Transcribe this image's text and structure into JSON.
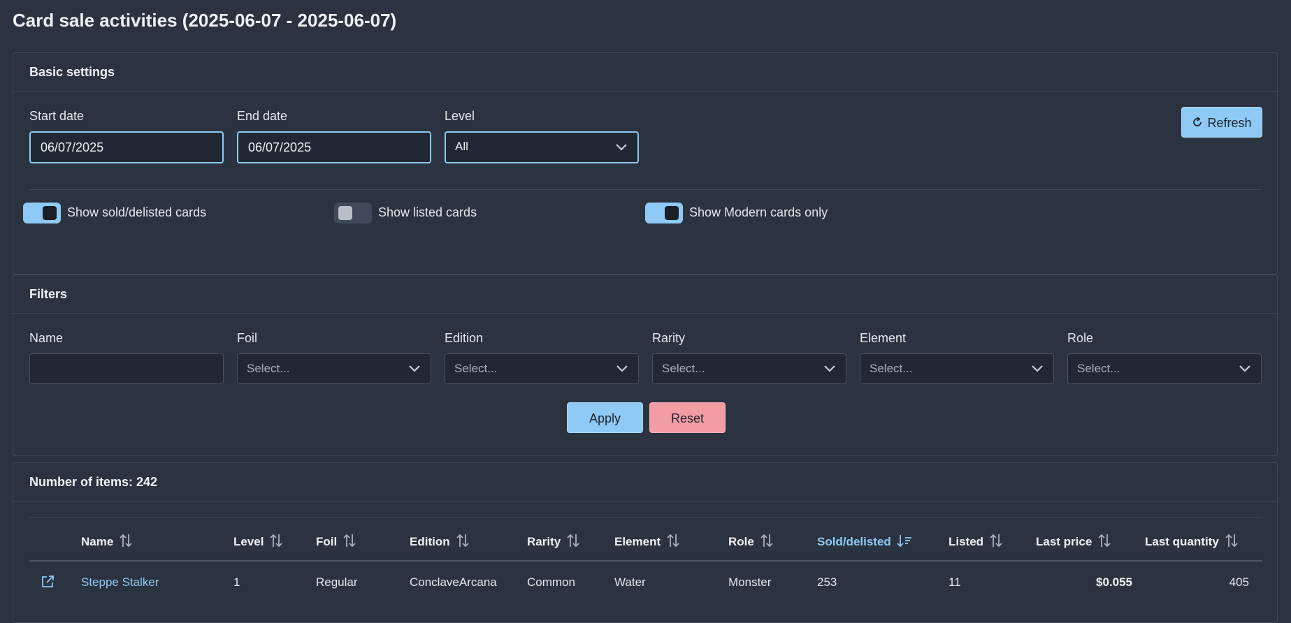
{
  "page": {
    "title": "Card sale activities (2025-06-07 - 2025-06-07)"
  },
  "colors": {
    "accent": "#8ecaf5",
    "danger": "#f29ca4",
    "background": "#2b3340"
  },
  "basic_settings": {
    "header": "Basic settings",
    "start_date": {
      "label": "Start date",
      "value": "06/07/2025"
    },
    "end_date": {
      "label": "End date",
      "value": "06/07/2025"
    },
    "level": {
      "label": "Level",
      "value": "All"
    },
    "refresh_label": "Refresh",
    "toggles": {
      "sold": {
        "label": "Show sold/delisted cards",
        "on": true
      },
      "listed": {
        "label": "Show listed cards",
        "on": false
      },
      "modern": {
        "label": "Show Modern cards only",
        "on": true
      }
    }
  },
  "filters": {
    "header": "Filters",
    "name": {
      "label": "Name",
      "value": ""
    },
    "foil": {
      "label": "Foil",
      "placeholder": "Select..."
    },
    "edition": {
      "label": "Edition",
      "placeholder": "Select..."
    },
    "rarity": {
      "label": "Rarity",
      "placeholder": "Select..."
    },
    "element": {
      "label": "Element",
      "placeholder": "Select..."
    },
    "role": {
      "label": "Role",
      "placeholder": "Select..."
    },
    "apply_label": "Apply",
    "reset_label": "Reset"
  },
  "results": {
    "header": "Number of items: 242",
    "columns": {
      "name": "Name",
      "level": "Level",
      "foil": "Foil",
      "edition": "Edition",
      "rarity": "Rarity",
      "element": "Element",
      "role": "Role",
      "sold": "Sold/delisted",
      "listed": "Listed",
      "last_price": "Last price",
      "last_quantity": "Last quantity"
    },
    "sorted_column": "Sold/delisted",
    "rows": [
      {
        "icon": "external-link-icon",
        "name": "Steppe Stalker",
        "level": "1",
        "foil": "Regular",
        "edition": "ConclaveArcana",
        "rarity": "Common",
        "element": "Water",
        "role": "Monster",
        "sold": "253",
        "listed": "11",
        "last_price": "$0.055",
        "last_quantity": "405"
      }
    ]
  }
}
